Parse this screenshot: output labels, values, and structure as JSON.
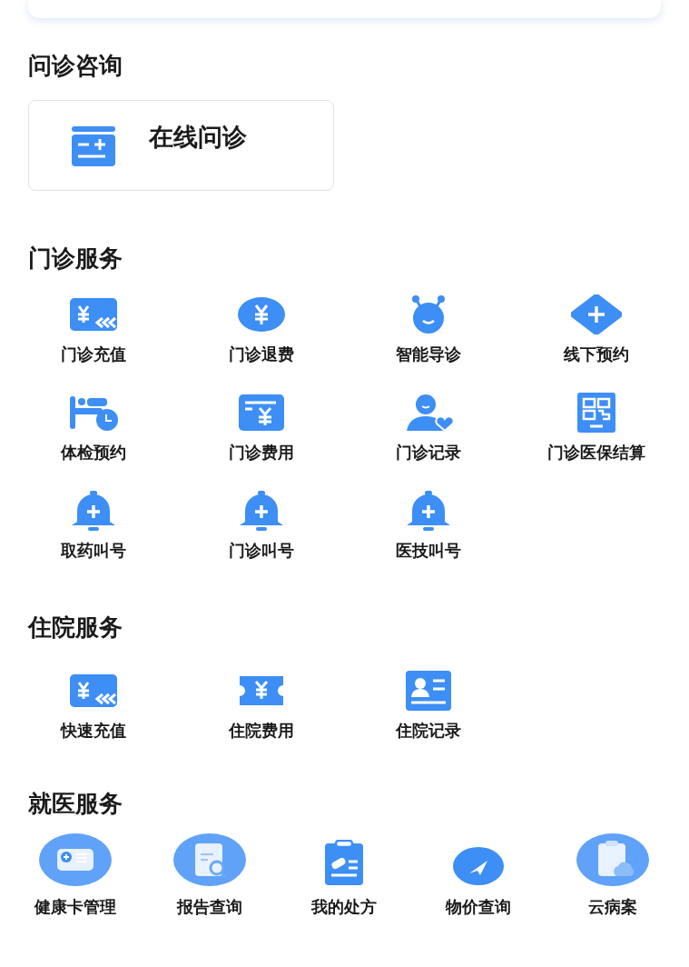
{
  "consult": {
    "title": "问诊咨询",
    "card": {
      "label": "在线问诊"
    }
  },
  "outpatient": {
    "title": "门诊服务",
    "items": [
      {
        "label": "门诊充值"
      },
      {
        "label": "门诊退费"
      },
      {
        "label": "智能导诊"
      },
      {
        "label": "线下预约"
      },
      {
        "label": "体检预约"
      },
      {
        "label": "门诊费用"
      },
      {
        "label": "门诊记录"
      },
      {
        "label": "门诊医保结算"
      },
      {
        "label": "取药叫号"
      },
      {
        "label": "门诊叫号"
      },
      {
        "label": "医技叫号"
      }
    ]
  },
  "inpatient": {
    "title": "住院服务",
    "items": [
      {
        "label": "快速充值"
      },
      {
        "label": "住院费用"
      },
      {
        "label": "住院记录"
      }
    ]
  },
  "medical": {
    "title": "就医服务",
    "items": [
      {
        "label": "健康卡管理"
      },
      {
        "label": "报告查询"
      },
      {
        "label": "我的处方"
      },
      {
        "label": "物价查询"
      },
      {
        "label": "云病案"
      }
    ]
  }
}
